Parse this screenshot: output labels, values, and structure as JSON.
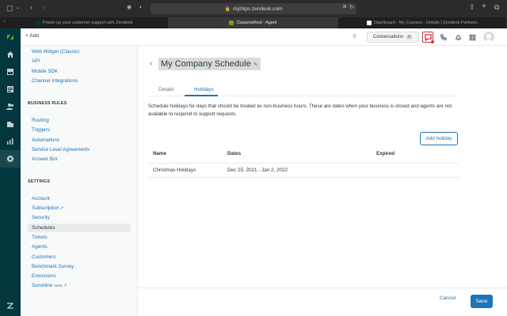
{
  "browser": {
    "url": "mjchips.zendesk.com",
    "tabs": [
      {
        "label": "Power up your customer support with Zendesk",
        "active": false
      },
      {
        "label": "Classmethod - Agent",
        "active": true
      },
      {
        "label": "Dashboard - My Courses - Details | Zendesk Partners",
        "active": false
      }
    ]
  },
  "header": {
    "add_label": "+ Add",
    "conversations_label": "Conversations",
    "conversations_count": "0"
  },
  "sidebar": {
    "top_links": [
      "Web Widget (Classic)",
      "API",
      "Mobile SDK",
      "Channel Integrations"
    ],
    "business_rules_heading": "BUSINESS RULES",
    "business_rules": [
      "Routing",
      "Triggers",
      "Automations",
      "Service Level Agreements",
      "Answer Bot"
    ],
    "settings_heading": "SETTINGS",
    "settings": {
      "account": "Account",
      "subscription": "Subscription",
      "security": "Security",
      "schedules": "Schedules",
      "tickets": "Tickets",
      "agents": "Agents",
      "customers": "Customers",
      "benchmark": "Benchmark Survey",
      "extensions": "Extensions",
      "sunshine": "Sunshine",
      "sunshine_badge": "NEW"
    }
  },
  "main": {
    "title": "My Company Schedule",
    "tabs": {
      "details": "Details",
      "holidays": "Holidays"
    },
    "description": "Schedule holidays for days that should be treated as non-business hours. These are dates when your business is closed and agents are not available to respond to support requests.",
    "add_holiday_label": "Add holiday",
    "table": {
      "headers": {
        "name": "Name",
        "dates": "Dates",
        "expired": "Expired"
      },
      "rows": [
        {
          "name": "Christmas Holidays",
          "dates": "Dec 25, 2021 - Jan 2, 2022",
          "expired": ""
        }
      ]
    },
    "cancel_label": "Cancel",
    "save_label": "Save"
  },
  "colors": {
    "rail": "#03363d",
    "accent": "#1f73b7",
    "alert": "#cc3340",
    "logo": "#78a300"
  }
}
